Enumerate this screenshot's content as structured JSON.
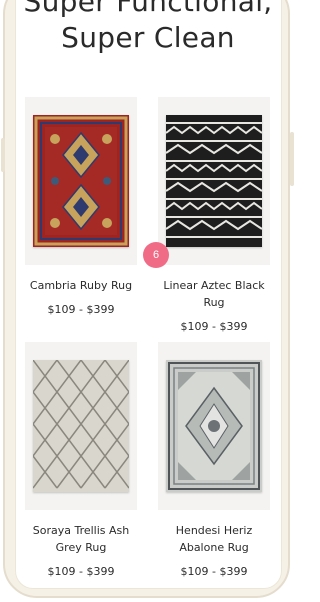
{
  "headline": {
    "line1": "Super Functional,",
    "line2": "Super Clean"
  },
  "products": [
    {
      "name": "Cambria Ruby Rug",
      "price": "$109 - $399",
      "image_icon": "rug-image"
    },
    {
      "name": "Linear Aztec Black Rug",
      "price": "$109 - $399",
      "image_icon": "rug-image"
    },
    {
      "name": "Soraya Trellis Ash Grey Rug",
      "price": "$109 - $399",
      "image_icon": "rug-image"
    },
    {
      "name": "Hendesi Heriz Abalone Rug",
      "price": "$109 - $399",
      "image_icon": "rug-image"
    }
  ],
  "badge": {
    "count": "6"
  },
  "colors": {
    "badge": "#f06c86",
    "frame": "#f6f1e7",
    "ruby_rug": "#9e2422",
    "aztec_rug": "#1e1e1e",
    "trellis_rug": "#d9d6ce",
    "heriz_rug": "#c9ccc8"
  }
}
